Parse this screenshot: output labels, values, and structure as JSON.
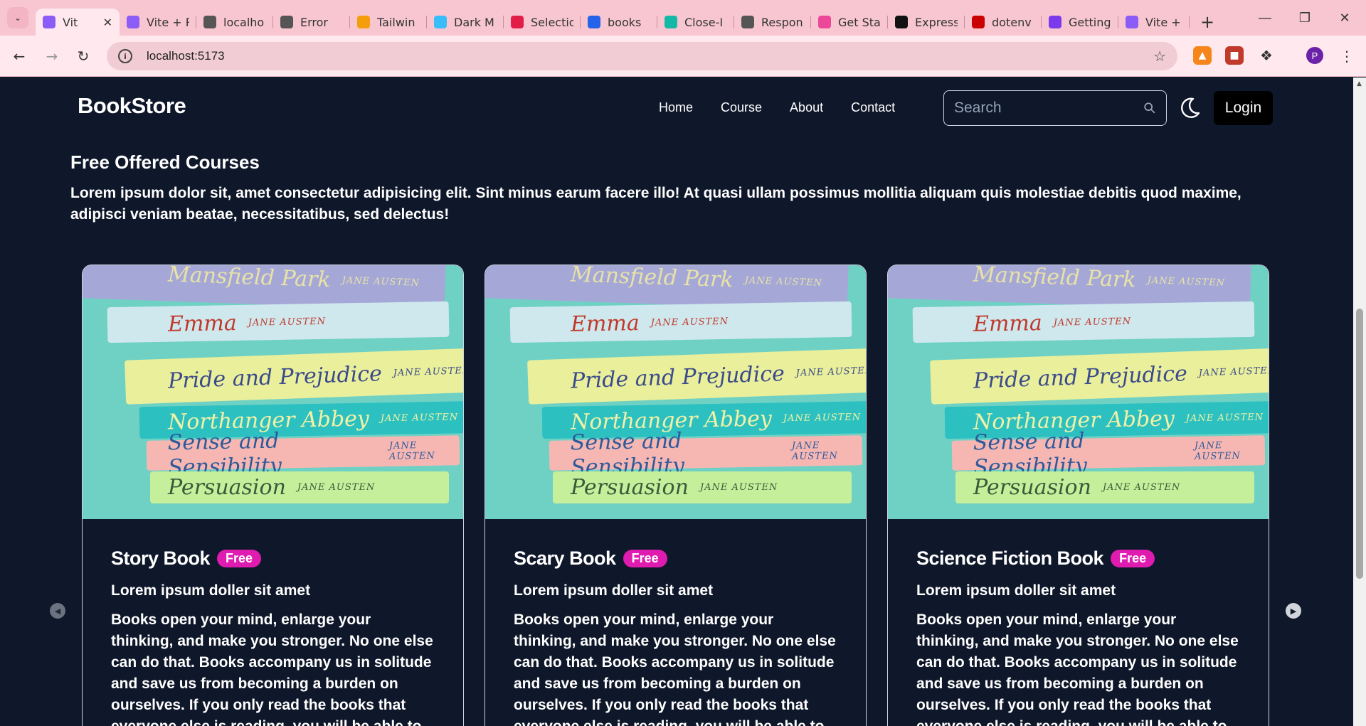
{
  "browser": {
    "tabs": [
      {
        "title": "Vit",
        "icon": "vite-icon",
        "color": "#8b5cf6",
        "active": true
      },
      {
        "title": "Vite + R",
        "icon": "vite-icon",
        "color": "#8b5cf6"
      },
      {
        "title": "localho",
        "icon": "globe-icon",
        "color": "#555555"
      },
      {
        "title": "Error",
        "icon": "globe-icon",
        "color": "#555555"
      },
      {
        "title": "Tailwin",
        "icon": "person-icon",
        "color": "#f59e0b"
      },
      {
        "title": "Dark M",
        "icon": "tailwind-icon",
        "color": "#38bdf8"
      },
      {
        "title": "Selectio",
        "icon": "figma-icon",
        "color": "#e11d48"
      },
      {
        "title": "books",
        "icon": "forms-icon",
        "color": "#2563eb"
      },
      {
        "title": "Close-I",
        "icon": "d-icon",
        "color": "#14b8a6"
      },
      {
        "title": "Respon",
        "icon": "globe-icon",
        "color": "#555555"
      },
      {
        "title": "Get Sta",
        "icon": "daisy-icon",
        "color": "#ec4899"
      },
      {
        "title": "Express",
        "icon": "express-icon",
        "color": "#111111"
      },
      {
        "title": "dotenv",
        "icon": "npm-icon",
        "color": "#cb0000"
      },
      {
        "title": "Getting",
        "icon": "bootstrap-icon",
        "color": "#7c3aed"
      },
      {
        "title": "Vite + R",
        "icon": "vite-icon",
        "color": "#8b5cf6"
      }
    ],
    "url": "localhost:5173",
    "profile_initial": "P"
  },
  "navbar": {
    "brand": "BookStore",
    "links": [
      "Home",
      "Course",
      "About",
      "Contact"
    ],
    "search_placeholder": "Search",
    "login_label": "Login"
  },
  "section": {
    "title": "Free Offered Courses",
    "description": "Lorem ipsum dolor sit, amet consectetur adipisicing elit. Sint minus earum facere illo! At quasi ullam possimus mollitia aliquam quis molestiae debitis quod maxime, adipisci veniam beatae, necessitatibus, sed delectus!"
  },
  "cards": [
    {
      "title": "Story Book",
      "badge": "Free",
      "subtitle": "Lorem ipsum doller sit amet",
      "text": "Books open your mind, enlarge your thinking, and make you stronger. No one else can do that. Books accompany us in solitude and save us from becoming a burden on ourselves. If you only read the books that everyone else is reading, you will be able to"
    },
    {
      "title": "Scary Book",
      "badge": "Free",
      "subtitle": "Lorem ipsum doller sit amet",
      "text": "Books open your mind, enlarge your thinking, and make you stronger. No one else can do that. Books accompany us in solitude and save us from becoming a burden on ourselves. If you only read the books that everyone else is reading, you will be able to"
    },
    {
      "title": "Science Fiction Book",
      "badge": "Free",
      "subtitle": "Lorem ipsum doller sit amet",
      "text": "Books open your mind, enlarge your thinking, and make you stronger. No one else can do that. Books accompany us in solitude and save us from becoming a burden on ourselves. If you only read the books that everyone else is reading, you will be able to"
    }
  ],
  "book_stack": [
    {
      "title": "Mansfield Park",
      "author": "JANE AUSTEN",
      "color": "#a5a8d6",
      "text_color": "#e8e2a8"
    },
    {
      "title": "Emma",
      "author": "JANE AUSTEN",
      "color": "#cfe8ee",
      "text_color": "#c0392b"
    },
    {
      "title": "Pride and Prejudice",
      "author": "JANE AUSTEN",
      "color": "#e9ef9a",
      "text_color": "#3b4a8c"
    },
    {
      "title": "Northanger Abbey",
      "author": "JANE AUSTEN",
      "color": "#2cc1c0",
      "text_color": "#f3f1a6"
    },
    {
      "title": "Sense and Sensibility",
      "author": "JANE AUSTEN",
      "color": "#f6b7b3",
      "text_color": "#2f5a9a"
    },
    {
      "title": "Persuasion",
      "author": "JANE AUSTEN",
      "color": "#c6ef9b",
      "text_color": "#3a5a3a"
    }
  ]
}
